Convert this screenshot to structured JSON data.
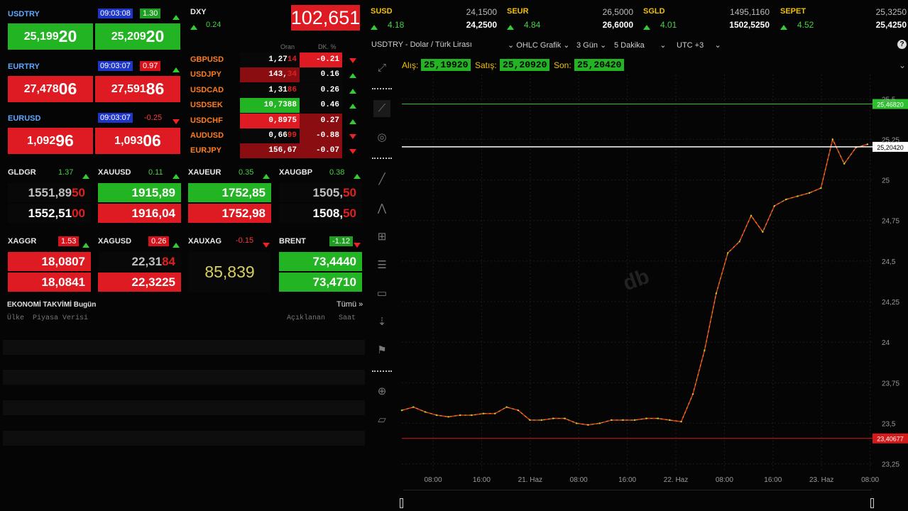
{
  "fx": [
    {
      "name": "USDTRY",
      "time": "09:03:08",
      "pct": "1.30",
      "pct_dir": "up",
      "bid_a": "25,199",
      "bid_b": "20",
      "ask_a": "25,209",
      "ask_b": "20",
      "bid_color": "green",
      "ask_color": "green"
    },
    {
      "name": "EURTRY",
      "time": "09:03:07",
      "pct": "0.97",
      "pct_dir": "up",
      "bid_a": "27,478",
      "bid_b": "06",
      "ask_a": "27,591",
      "ask_b": "86",
      "bid_color": "red",
      "ask_color": "red"
    },
    {
      "name": "EURUSD",
      "time": "09:03:07",
      "pct": "-0.25",
      "pct_dir": "down",
      "bid_a": "1,092",
      "bid_b": "96",
      "ask_a": "1,093",
      "ask_b": "06",
      "bid_color": "red",
      "ask_color": "red"
    }
  ],
  "dxy": {
    "name": "DXY",
    "change": "0.24",
    "value": "102,651"
  },
  "cross_header": {
    "col1": "Oran",
    "col2": "DK. %"
  },
  "cross": [
    {
      "name": "GBPUSD",
      "v_a": "1,27",
      "v_b": "14",
      "chg": "-0.21",
      "dir": "down",
      "vbg": "#080808",
      "cbg": "#de1a22"
    },
    {
      "name": "USDJPY",
      "v_a": "143,",
      "v_b": "34",
      "chg": "0.16",
      "dir": "up",
      "vbg": "#8a0d12",
      "cbg": "#080808"
    },
    {
      "name": "USDCAD",
      "v_a": "1,31",
      "v_b": "86",
      "chg": "0.26",
      "dir": "up",
      "vbg": "#080808",
      "cbg": "#080808"
    },
    {
      "name": "USDSEK",
      "v_a": "10,7388",
      "v_b": "",
      "chg": "0.46",
      "dir": "up",
      "vbg": "#22b422",
      "cbg": "#080808"
    },
    {
      "name": "USDCHF",
      "v_a": "0,8975",
      "v_b": "",
      "chg": "0.27",
      "dir": "up",
      "vbg": "#de1a22",
      "cbg": "#8a0d12"
    },
    {
      "name": "AUDUSD",
      "v_a": "0,66",
      "v_b": "99",
      "chg": "-0.88",
      "dir": "down",
      "vbg": "#080808",
      "cbg": "#8a0d12"
    },
    {
      "name": "EURJPY",
      "v_a": "156,67",
      "v_b": "",
      "chg": "-0.07",
      "dir": "down",
      "vbg": "#8a0d12",
      "cbg": "#8a0d12"
    }
  ],
  "metals": [
    {
      "name": "GLDGR",
      "pct": "1.37",
      "top_a": "1551,89",
      "top_b": "50",
      "bot_a": "1552,51",
      "bot_b": "00"
    },
    {
      "name": "XAUUSD",
      "pct": "0.11",
      "top": "1915,89",
      "bot": "1916,04"
    },
    {
      "name": "XAUEUR",
      "pct": "0.35",
      "top": "1752,85",
      "bot": "1752,98"
    },
    {
      "name": "XAUGBP",
      "pct": "0.38",
      "top_a": "1505,",
      "top_b": "50",
      "bot_a": "1508,",
      "bot_b": "50"
    }
  ],
  "silver": [
    {
      "name": "XAGGR",
      "pct": "1.53",
      "top": "18,0807",
      "bot": "18,0841"
    },
    {
      "name": "XAGUSD",
      "pct": "0.26",
      "top_a": "22,31",
      "top_b": "84",
      "bot": "22,3225"
    },
    {
      "name": "XAUXAG",
      "pct": "-0.15",
      "value": "85,839"
    },
    {
      "name": "BRENT",
      "pct": "-1.12",
      "top": "73,4440",
      "bot": "73,4710"
    }
  ],
  "calendar": {
    "title": "EKONOMİ TAKVİMİ",
    "subtitle": "Bugün",
    "all": "Tümü »",
    "col_country": "Ülke",
    "col_data": "Piyasa Verisi",
    "col_announced": "Açıklanan",
    "col_time": "Saat"
  },
  "tickers": [
    {
      "name": "SUSD",
      "pct": "4.18",
      "v1": "24,1500",
      "v2": "24,2500"
    },
    {
      "name": "SEUR",
      "pct": "4.84",
      "v1": "26,5000",
      "v2": "26,6000"
    },
    {
      "name": "SGLD",
      "pct": "4.01",
      "v1": "1495,1160",
      "v2": "1502,5250"
    },
    {
      "name": "SEPET",
      "pct": "4.52",
      "v1": "25,3250",
      "v2": "25,4250"
    }
  ],
  "chart_toolbar": {
    "symbol": "USDTRY - Dolar / Türk Lirası",
    "type": "OHLC Grafik",
    "range": "3 Gün",
    "interval": "5 Dakika",
    "tz": "UTC +3"
  },
  "quote": {
    "bid_label": "Alış:",
    "bid": "25,19920",
    "ask_label": "Satış:",
    "ask": "25,20920",
    "last_label": "Son:",
    "last": "25,20420"
  },
  "watermark": "db",
  "chart_data": {
    "type": "line",
    "title": "",
    "y_ticks": [
      "25,5",
      "25,25",
      "25",
      "24,75",
      "24,5",
      "24,25",
      "24",
      "23,75",
      "23,5",
      "23,25"
    ],
    "x_ticks": [
      "08:00",
      "16:00",
      "21. Haz",
      "08:00",
      "16:00",
      "22. Haz",
      "08:00",
      "16:00",
      "23. Haz",
      "08:00"
    ],
    "ylim": [
      23.2,
      25.65
    ],
    "markers": {
      "high": "25,46820",
      "last": "25,20420",
      "low": "23,40677"
    },
    "series": [
      {
        "values": [
          23.58,
          23.6,
          23.57,
          23.55,
          23.54,
          23.55,
          23.55,
          23.56,
          23.56,
          23.6,
          23.58,
          23.52,
          23.52,
          23.53,
          23.53,
          23.5,
          23.49,
          23.5,
          23.52,
          23.52,
          23.52,
          23.53,
          23.53,
          23.52,
          23.51,
          23.68,
          23.95,
          24.3,
          24.55,
          24.62,
          24.78,
          24.68,
          24.84,
          24.88,
          24.9,
          24.92,
          24.95,
          25.25,
          25.1,
          25.2,
          25.22
        ]
      }
    ]
  },
  "colors": {
    "up": "#22b422",
    "down": "#de1a22",
    "accent_blue": "#5fa8ff",
    "accent_orange": "#ff7d1e"
  }
}
